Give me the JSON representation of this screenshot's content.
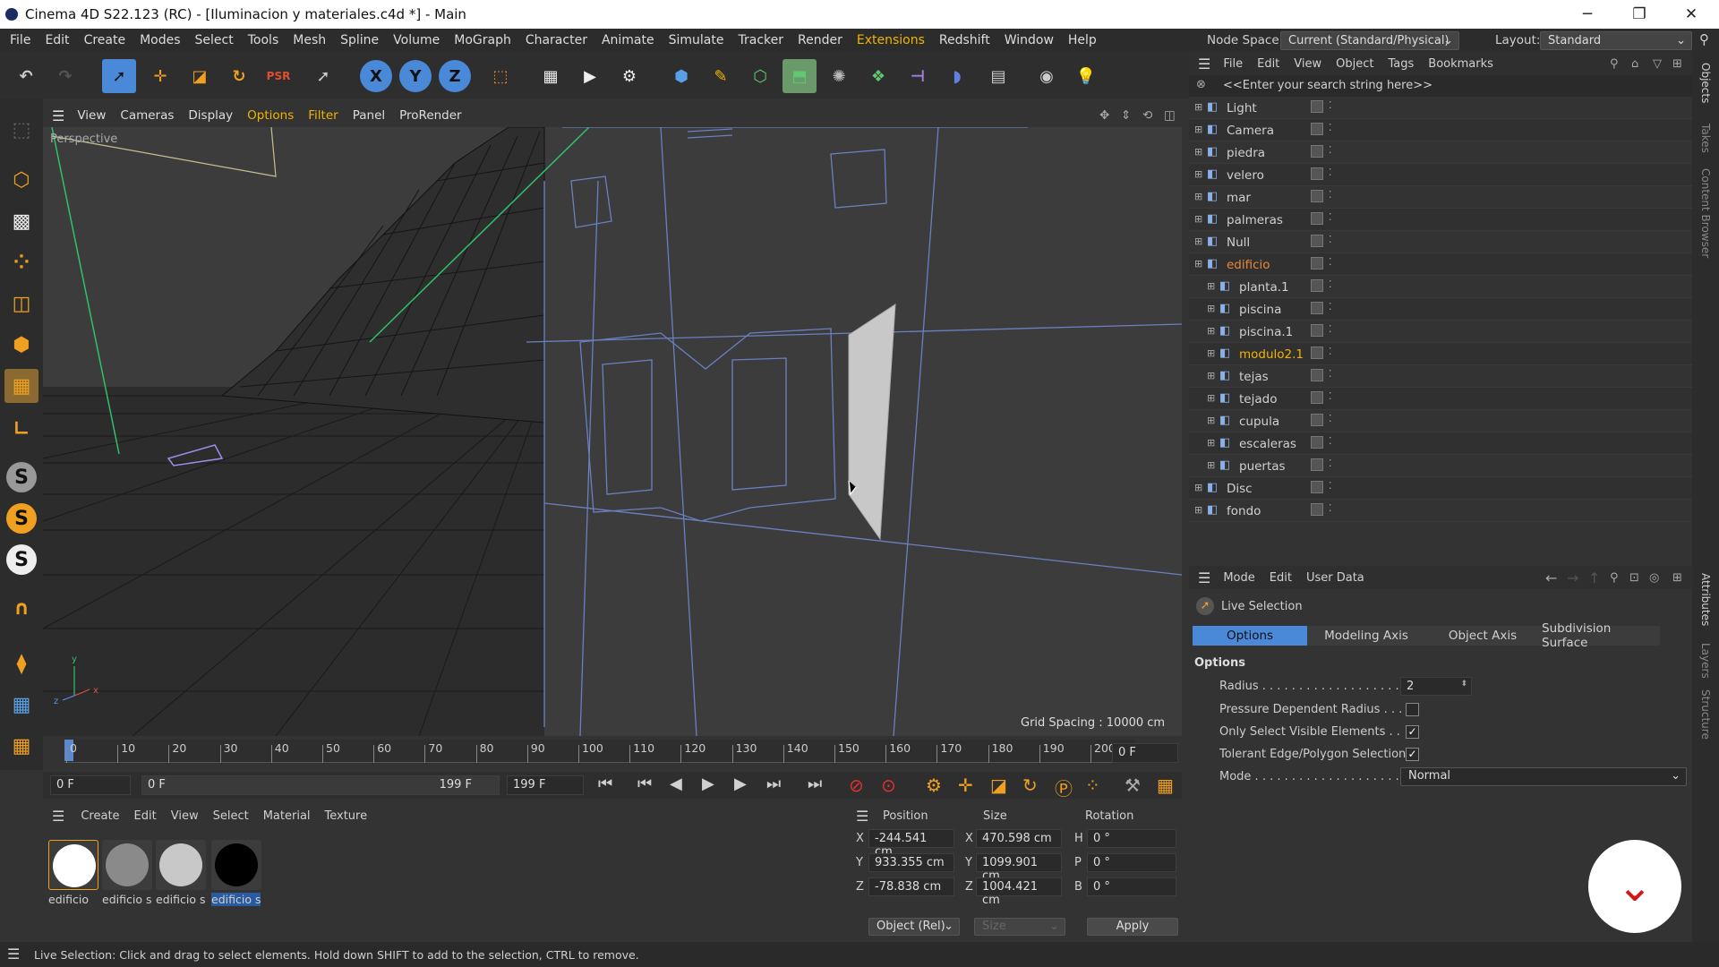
{
  "window": {
    "title": "Cinema 4D S22.123 (RC) - [Iluminacion y materiales.c4d *] - Main",
    "minimize": "─",
    "maximize": "❐",
    "close": "✕"
  },
  "menu": [
    "File",
    "Edit",
    "Create",
    "Modes",
    "Select",
    "Tools",
    "Mesh",
    "Spline",
    "Volume",
    "MoGraph",
    "Character",
    "Animate",
    "Simulate",
    "Tracker",
    "Render",
    "Extensions",
    "Redshift",
    "Window",
    "Help"
  ],
  "nodespace": {
    "label": "Node Space:",
    "value": "Current (Standard/Physical)",
    "layout_label": "Layout:",
    "layout_value": "Standard"
  },
  "viewport": {
    "menu": [
      "View",
      "Cameras",
      "Display",
      "Options",
      "Filter",
      "Panel",
      "ProRender"
    ],
    "label": "Perspective",
    "grid": "Grid Spacing : 10000 cm"
  },
  "timeline": {
    "ticks": [
      "0",
      "10",
      "20",
      "30",
      "40",
      "50",
      "60",
      "70",
      "80",
      "90",
      "100",
      "110",
      "120",
      "130",
      "140",
      "150",
      "160",
      "170",
      "180",
      "190",
      "200"
    ],
    "current": "0 F"
  },
  "transport": {
    "start": "0 F",
    "range_start": "0 F",
    "range_end": "199 F",
    "end": "199 F"
  },
  "materials": {
    "menu": [
      "Create",
      "Edit",
      "View",
      "Select",
      "Material",
      "Texture"
    ],
    "items": [
      {
        "name": "edificio",
        "color": "#ffffff"
      },
      {
        "name": "edificio s",
        "color": "#8a8a8a"
      },
      {
        "name": "edificio s",
        "color": "#c8c8c8"
      },
      {
        "name": "edificio s",
        "color": "#000000"
      }
    ]
  },
  "coords": {
    "headers": [
      "Position",
      "Size",
      "Rotation"
    ],
    "rows": [
      {
        "axis": "X",
        "pos": "-244.541 cm",
        "size_axis": "X",
        "size": "470.598 cm",
        "rot_axis": "H",
        "rot": "0 °"
      },
      {
        "axis": "Y",
        "pos": "933.355 cm",
        "size_axis": "Y",
        "size": "1099.901 cm",
        "rot_axis": "P",
        "rot": "0 °"
      },
      {
        "axis": "Z",
        "pos": "-78.838 cm",
        "size_axis": "Z",
        "size": "1004.421 cm",
        "rot_axis": "B",
        "rot": "0 °"
      }
    ],
    "mode": "Object (Rel)",
    "size_mode": "Size",
    "apply": "Apply"
  },
  "objects": {
    "menu": [
      "File",
      "Edit",
      "View",
      "Object",
      "Tags",
      "Bookmarks"
    ],
    "search": "<<Enter your search string here>>",
    "items": [
      {
        "name": "Light",
        "indent": 0,
        "color": "#d0d0d0"
      },
      {
        "name": "Camera",
        "indent": 0,
        "color": "#d0d0d0"
      },
      {
        "name": "piedra",
        "indent": 0,
        "color": "#d0d0d0"
      },
      {
        "name": "velero",
        "indent": 0,
        "color": "#d0d0d0"
      },
      {
        "name": "mar",
        "indent": 0,
        "color": "#d0d0d0"
      },
      {
        "name": "palmeras",
        "indent": 0,
        "color": "#d0d0d0"
      },
      {
        "name": "Null",
        "indent": 0,
        "color": "#d0d0d0"
      },
      {
        "name": "edificio",
        "indent": 0,
        "color": "#e8883a"
      },
      {
        "name": "planta.1",
        "indent": 1,
        "color": "#d0d0d0"
      },
      {
        "name": "piscina",
        "indent": 1,
        "color": "#d0d0d0"
      },
      {
        "name": "piscina.1",
        "indent": 1,
        "color": "#d0d0d0"
      },
      {
        "name": "modulo2.1",
        "indent": 1,
        "color": "#f0b400"
      },
      {
        "name": "tejas",
        "indent": 1,
        "color": "#d0d0d0"
      },
      {
        "name": "tejado",
        "indent": 1,
        "color": "#d0d0d0"
      },
      {
        "name": "cupula",
        "indent": 1,
        "color": "#d0d0d0"
      },
      {
        "name": "escaleras",
        "indent": 1,
        "color": "#d0d0d0"
      },
      {
        "name": "puertas",
        "indent": 1,
        "color": "#d0d0d0"
      },
      {
        "name": "Disc",
        "indent": 0,
        "color": "#d0d0d0"
      },
      {
        "name": "fondo",
        "indent": 0,
        "color": "#d0d0d0"
      }
    ]
  },
  "attributes": {
    "menu": [
      "Mode",
      "Edit",
      "User Data"
    ],
    "tool": "Live Selection",
    "tabs": [
      "Options",
      "Modeling Axis",
      "Object Axis",
      "Subdivision Surface"
    ],
    "section": "Options",
    "radius_label": "Radius . . . . . . . . . . . . . . . . . . . . . .",
    "radius": "2",
    "pressure": "Pressure Dependent Radius . . .",
    "visible": "Only Select Visible Elements . .",
    "tolerant": "Tolerant Edge/Polygon Selection",
    "mode_label": "Mode . . . . . . . . . . . . . . . . . . . . . . .",
    "mode": "Normal",
    "check": "✓"
  },
  "side_tabs": [
    "Objects",
    "Takes",
    "Content Browser",
    "Attributes",
    "Layers",
    "Structure"
  ],
  "status": "Live Selection: Click and drag to select elements. Hold down SHIFT to add to the selection, CTRL to remove."
}
